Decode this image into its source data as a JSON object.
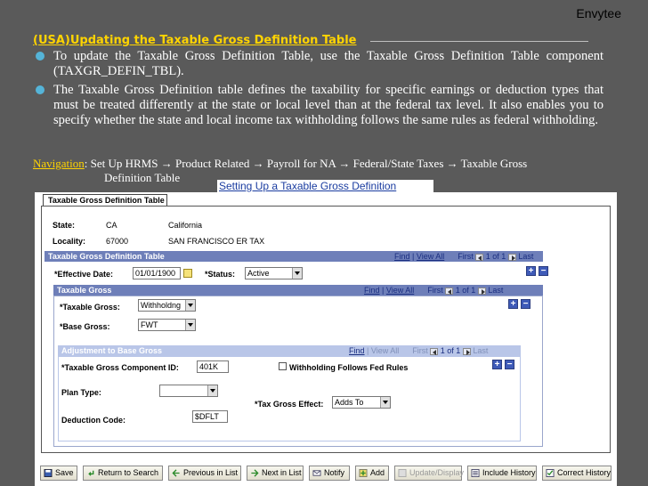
{
  "brand": "Envytee",
  "slide_title": "(USA)Updating the Taxable Gross Definition Table",
  "bullets": [
    "To update the Taxable Gross Definition Table, use the Taxable Gross Definition Table component (TAXGR_DEFIN_TBL).",
    "The Taxable Gross Definition table defines the taxability for specific earnings or deduction types that must be treated differently at the state or local level than at the federal tax level. It also enables you to specify whether the state and local income tax withholding follows the same rules as federal withholding."
  ],
  "navigation": {
    "label": "Navigation",
    "path": ": Set Up HRMS → Product Related → Payroll for NA → Federal/State Taxes → Taxable Gross",
    "path_cont": "Definition Table"
  },
  "caption": "Setting Up a Taxable Gross Definition",
  "ps": {
    "tab": "Taxable Gross Definition Table",
    "state_label": "State:",
    "state_code": "CA",
    "state_name": "California",
    "locality_label": "Locality:",
    "locality_code": "67000",
    "locality_name": "SAN FRANCISCO ER TAX",
    "pager": {
      "find": "Find",
      "view_all": "View All",
      "first": "First",
      "range": "1 of 1",
      "last": "Last",
      "sep": "|"
    },
    "def_bar": "Taxable Gross Definition Table",
    "eff_date_label": "*Effective Date:",
    "eff_date": "01/01/1900",
    "status_label": "*Status:",
    "status": "Active",
    "tg_bar": "Taxable Gross",
    "taxable_gross_label": "*Taxable Gross:",
    "taxable_gross": "Withholdng",
    "base_gross_label": "*Base Gross:",
    "base_gross": "FWT",
    "adj_bar": "Adjustment to Base Gross",
    "component_label": "*Taxable Gross Component ID:",
    "component": "401K",
    "withholding_label": "Withholding Follows Fed Rules",
    "plan_type_label": "Plan Type:",
    "plan_type": "",
    "effect_label": "*Tax Gross Effect:",
    "effect": "Adds To",
    "deduction_label": "Deduction Code:",
    "deduction": "$DFLT",
    "buttons": {
      "save": "Save",
      "return": "Return to Search",
      "prev": "Previous in List",
      "next": "Next in List",
      "notify": "Notify",
      "add": "Add",
      "update": "Update/Display",
      "include": "Include History",
      "correct": "Correct History"
    }
  }
}
